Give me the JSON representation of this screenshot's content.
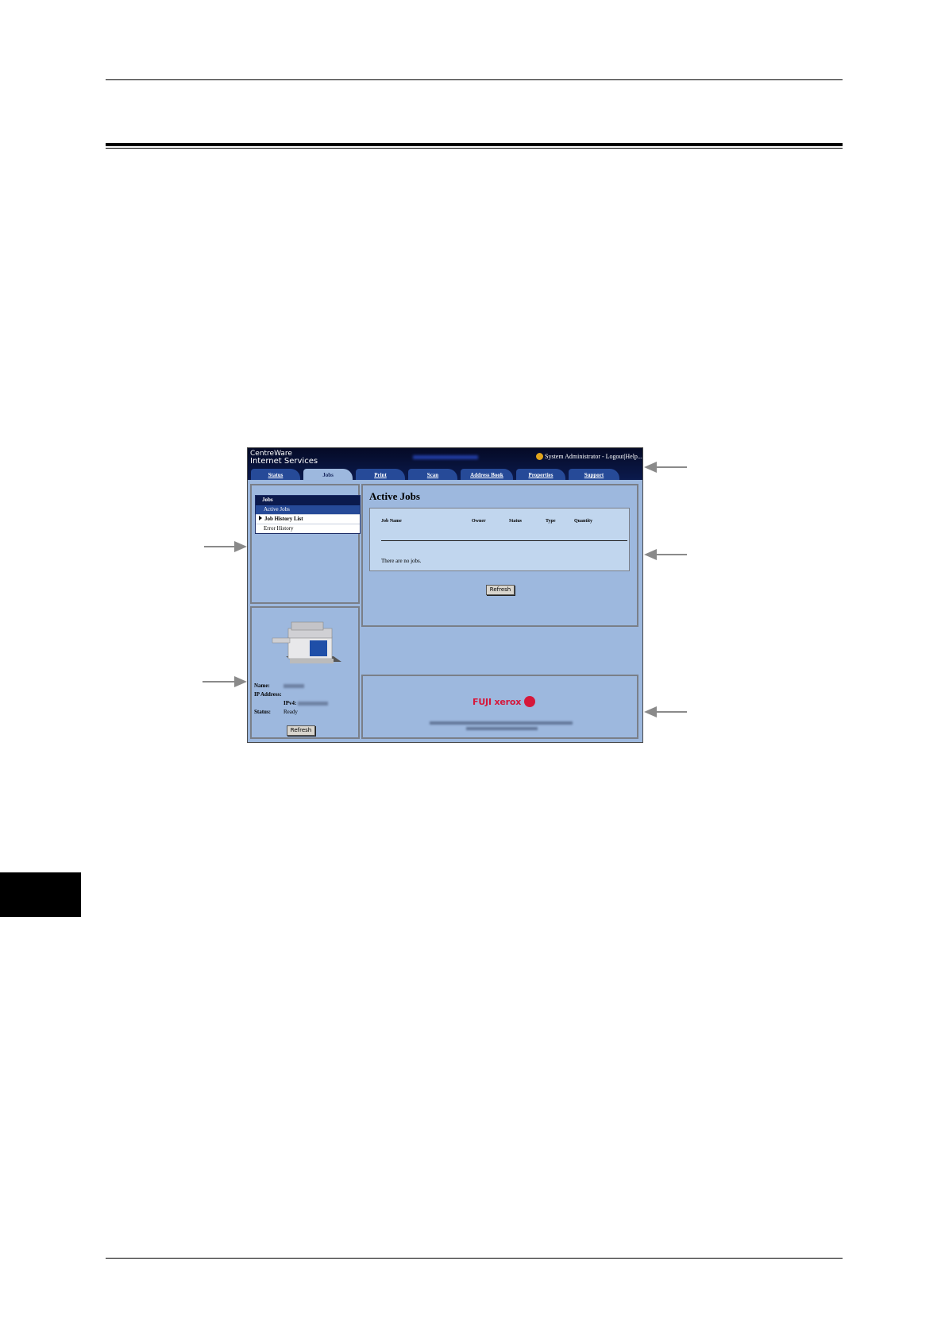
{
  "header": {
    "brand_line1": "CentreWare",
    "brand_line2": "Internet Services",
    "user_text": "System Administrator - Logout|Help..."
  },
  "tabs": [
    {
      "label": "Status",
      "active": false
    },
    {
      "label": "Jobs",
      "active": true
    },
    {
      "label": "Print",
      "active": false
    },
    {
      "label": "Scan",
      "active": false
    },
    {
      "label": "Address Book",
      "active": false
    },
    {
      "label": "Properties",
      "active": false
    },
    {
      "label": "Support",
      "active": false
    }
  ],
  "menu": {
    "header": "Jobs",
    "items": [
      {
        "label": "Active Jobs",
        "selected": true
      },
      {
        "label": "Job History List",
        "bold": true
      },
      {
        "label": "Error History"
      }
    ]
  },
  "device": {
    "name_label": "Name:",
    "ip_label": "IP Address:",
    "ipv4_label": "IPv4:",
    "status_label": "Status:",
    "status_value": "Ready",
    "refresh_label": "Refresh"
  },
  "main": {
    "title": "Active Jobs",
    "columns": [
      "Job Name",
      "Owner",
      "Status",
      "Type",
      "Quantity"
    ],
    "empty_text": "There are no jobs.",
    "refresh_label": "Refresh"
  },
  "footer": {
    "logo_text": "FUJI xerox"
  },
  "colors": {
    "panel_bg": "#9db8de",
    "header_bg": "#0b1a4d",
    "tab_bg": "#264a98",
    "brand_red": "#d6173a"
  }
}
